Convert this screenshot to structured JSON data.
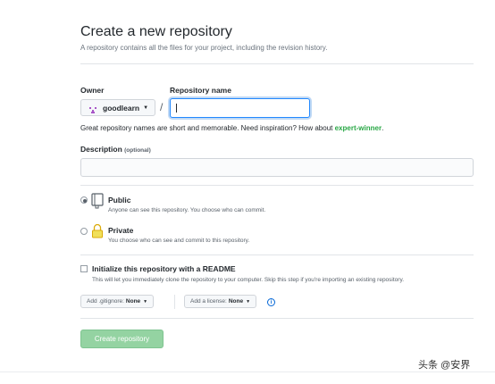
{
  "page": {
    "title": "Create a new repository",
    "subtitle": "A repository contains all the files for your project, including the revision history."
  },
  "owner": {
    "label": "Owner",
    "value": "goodlearn"
  },
  "repo": {
    "label": "Repository name",
    "value": "",
    "hint_prefix": "Great repository names are short and memorable. Need inspiration? How about ",
    "suggestion": "expert-winner",
    "hint_suffix": "."
  },
  "description": {
    "label": "Description",
    "optional": "(optional)",
    "value": ""
  },
  "visibility": {
    "selected": "public",
    "public": {
      "title": "Public",
      "desc": "Anyone can see this repository. You choose who can commit."
    },
    "private": {
      "title": "Private",
      "desc": "You choose who can see and commit to this repository."
    }
  },
  "init": {
    "checked": false,
    "title": "Initialize this repository with a README",
    "desc": "This will let you immediately clone the repository to your computer. Skip this step if you're importing an existing repository."
  },
  "gitignore": {
    "prefix": "Add .gitignore:",
    "value": "None"
  },
  "license": {
    "prefix": "Add a license:",
    "value": "None"
  },
  "submit": {
    "label": "Create repository"
  },
  "watermark": {
    "text": "头条 @安界"
  },
  "colors": {
    "accent": "#0366d6",
    "suggestion": "#28a745",
    "button_disabled": "#94d3a2"
  }
}
